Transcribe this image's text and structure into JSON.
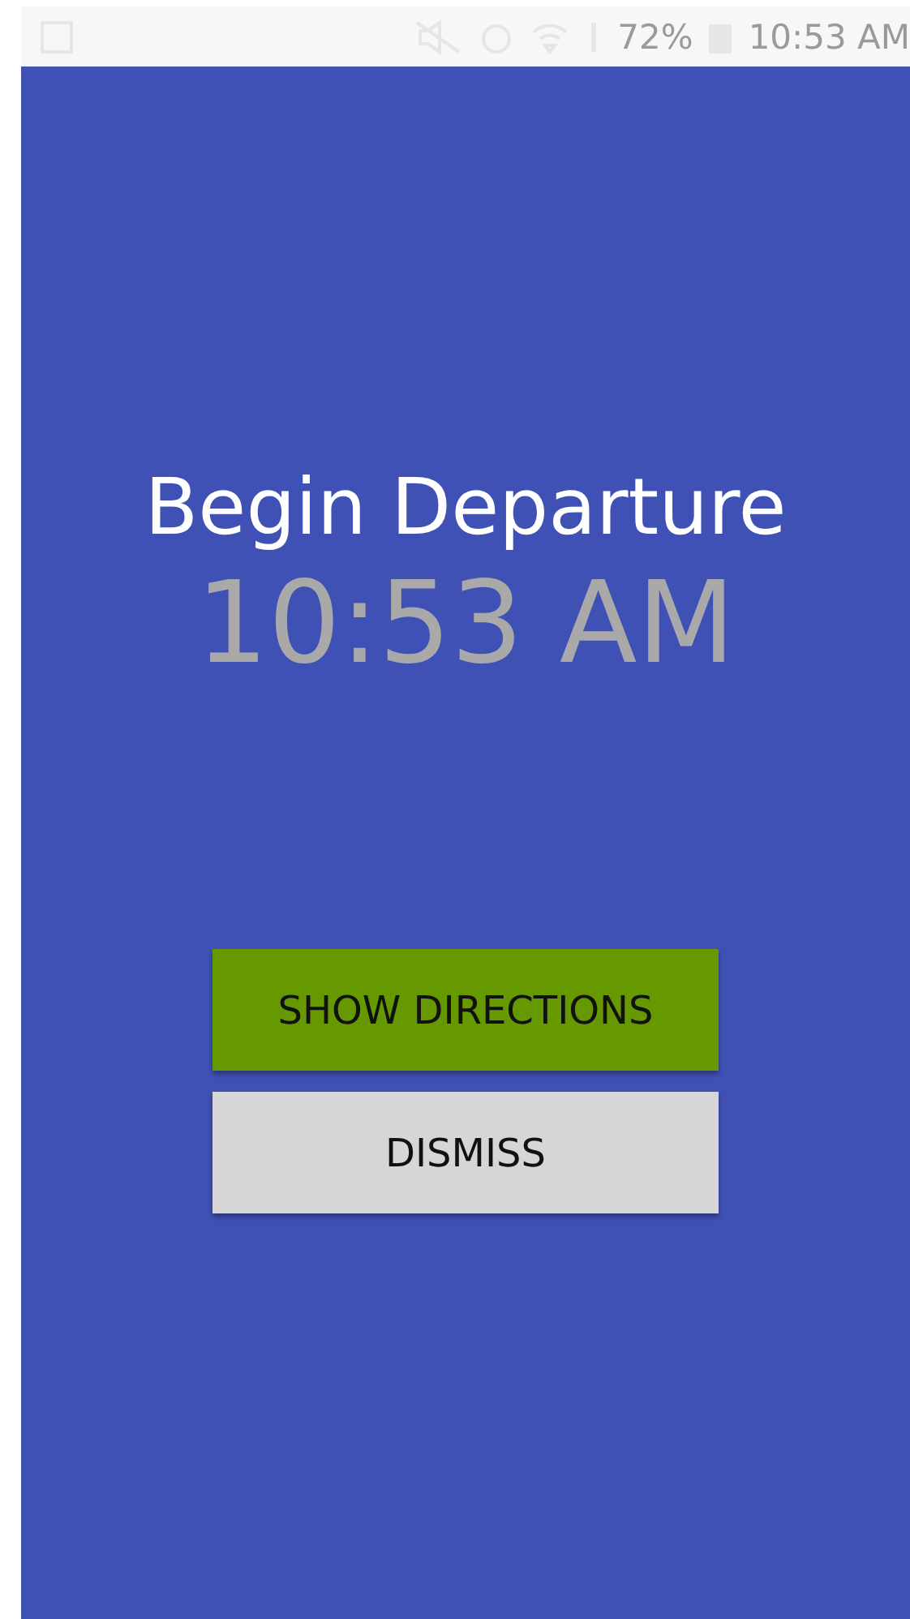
{
  "status_bar": {
    "battery": "72%",
    "time": "10:53 AM"
  },
  "alarm": {
    "title": "Begin Departure",
    "time": "10:53 AM"
  },
  "buttons": [
    {
      "label": "SHOW DIRECTIONS",
      "kind": "primary"
    },
    {
      "label": "DISMISS",
      "kind": "secondary"
    }
  ]
}
